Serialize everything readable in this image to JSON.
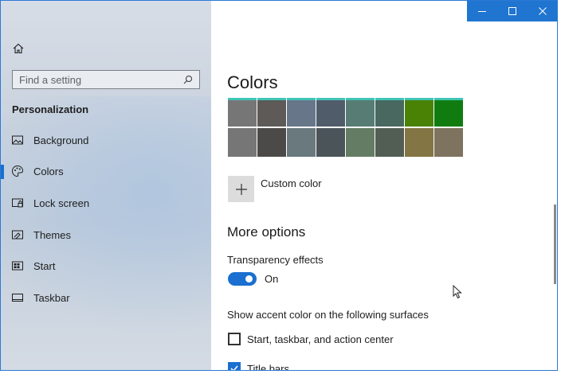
{
  "sidebar": {
    "search_placeholder": "Find a setting",
    "section_title": "Personalization",
    "items": [
      {
        "label": "Background",
        "icon": "picture-icon"
      },
      {
        "label": "Colors",
        "icon": "palette-icon",
        "active": true
      },
      {
        "label": "Lock screen",
        "icon": "lock-screen-icon"
      },
      {
        "label": "Themes",
        "icon": "themes-icon"
      },
      {
        "label": "Start",
        "icon": "start-icon"
      },
      {
        "label": "Taskbar",
        "icon": "taskbar-icon"
      }
    ]
  },
  "colors": {
    "accent": "#1a6fd0",
    "swatches_row1": [
      "#767676",
      "#5d5a58",
      "#68768a",
      "#515c6b",
      "#567c73",
      "#486860",
      "#498205",
      "#107c10"
    ],
    "swatches_row2": [
      "#767676",
      "#4c4a48",
      "#69797e",
      "#4a5459",
      "#647c64",
      "#525e54",
      "#847545",
      "#7e735f"
    ]
  },
  "content": {
    "title": "Colors",
    "custom_color_label": "Custom color",
    "more_options": "More options",
    "transparency_label": "Transparency effects",
    "transparency_state": "On",
    "surfaces_label": "Show accent color on the following surfaces",
    "checkbox_start": "Start, taskbar, and action center",
    "checkbox_titlebars": "Title bars"
  }
}
